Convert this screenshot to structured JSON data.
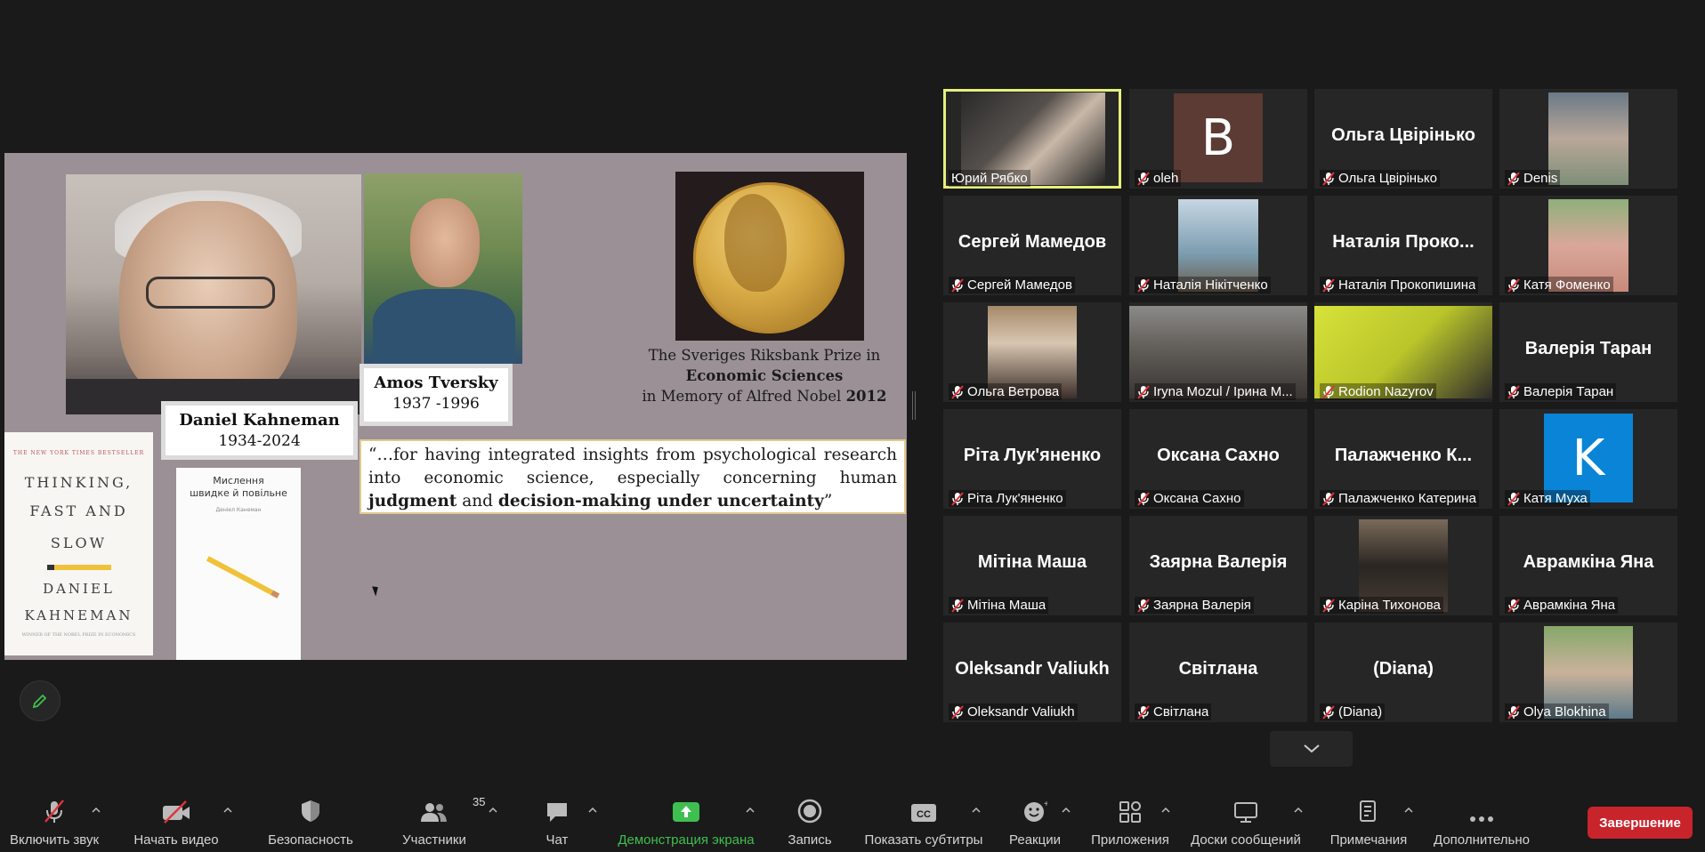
{
  "slide": {
    "kahneman_name": "Daniel Kahneman",
    "kahneman_years": "1934-2024",
    "tversky_name": "Amos Tversky",
    "tversky_years": "1937 -1996",
    "prize_line1": "The Sveriges Riksbank Prize in",
    "prize_line2": "Economic Sciences",
    "prize_line3a": "in Memory of Alfred Nobel ",
    "prize_line3b": "2012",
    "quote_a": "“…for having integrated insights from psychological research into economic science, especially concerning human ",
    "quote_b": "judgment",
    "quote_c": " and ",
    "quote_d": "decision-making under uncertainty",
    "quote_e": "”",
    "book1_top": "THE NEW YORK TIMES BESTSELLER",
    "book1_title_1": "THINKING,",
    "book1_title_2": "FAST AND SLOW",
    "book1_author_1": "DANIEL",
    "book1_author_2": "KAHNEMAN",
    "book1_winner": "WINNER OF THE NOBEL PRIZE IN ECONOMICS",
    "book2_title_1": "Мислення",
    "book2_title_2": "швидке й повільне",
    "book2_author": "Деніел Канеман"
  },
  "participants": [
    {
      "name": "Юрий Рябко",
      "big": "",
      "muted": false,
      "type": "video",
      "active": true
    },
    {
      "name": "oleh",
      "big": "",
      "muted": true,
      "type": "letter",
      "letter": "B",
      "color": "#5b3b33"
    },
    {
      "name": "Ольга Цвірінько",
      "big": "Ольга Цвірінько",
      "muted": true,
      "type": "name"
    },
    {
      "name": "Denis",
      "big": "",
      "muted": true,
      "type": "photo"
    },
    {
      "name": "Сергей Мамедов",
      "big": "Сергей Мамедов",
      "muted": true,
      "type": "name"
    },
    {
      "name": "Наталія Нікітченко",
      "big": "",
      "muted": true,
      "type": "photo"
    },
    {
      "name": "Наталія Прокопишина",
      "big": "Наталія Проко...",
      "muted": true,
      "type": "name"
    },
    {
      "name": "Катя Фоменко",
      "big": "",
      "muted": true,
      "type": "photo"
    },
    {
      "name": "Ольга Ветрова",
      "big": "",
      "muted": true,
      "type": "photo"
    },
    {
      "name": "Iryna Mozul / Ірина М...",
      "big": "",
      "muted": true,
      "type": "video"
    },
    {
      "name": "Rodion Nazyrov",
      "big": "",
      "muted": true,
      "type": "video"
    },
    {
      "name": "Валерія Таран",
      "big": "Валерія Таран",
      "muted": true,
      "type": "name"
    },
    {
      "name": "Ріта Лук'яненко",
      "big": "Ріта Лук'яненко",
      "muted": true,
      "type": "name"
    },
    {
      "name": "Оксана Сахно",
      "big": "Оксана Сахно",
      "muted": true,
      "type": "name"
    },
    {
      "name": "Палажченко Катерина",
      "big": "Палажченко К...",
      "muted": true,
      "type": "name"
    },
    {
      "name": "Катя Муха",
      "big": "",
      "muted": true,
      "type": "letter",
      "letter": "K",
      "color": "#0a84d6"
    },
    {
      "name": "Мітіна Маша",
      "big": "Мітіна Маша",
      "muted": true,
      "type": "name"
    },
    {
      "name": "Заярна Валерія",
      "big": "Заярна Валерія",
      "muted": true,
      "type": "name"
    },
    {
      "name": "Каріна Тихонова",
      "big": "",
      "muted": true,
      "type": "photo"
    },
    {
      "name": "Аврамкіна Яна",
      "big": "Аврамкіна Яна",
      "muted": true,
      "type": "name"
    },
    {
      "name": "Oleksandr Valiukh",
      "big": "Oleksandr Valiukh",
      "muted": true,
      "type": "name"
    },
    {
      "name": "Світлана",
      "big": "Світлана",
      "muted": true,
      "type": "name"
    },
    {
      "name": "(Diana)",
      "big": "(Diana)",
      "muted": true,
      "type": "name"
    },
    {
      "name": "Olya Blokhina",
      "big": "",
      "muted": true,
      "type": "photo"
    }
  ],
  "toolbar": {
    "audio": "Включить звук",
    "video": "Начать видео",
    "security": "Безопасность",
    "participants": "Участники",
    "participants_count": "35",
    "chat": "Чат",
    "share": "Демонстрация экрана",
    "record": "Запись",
    "captions": "Показать субтитры",
    "reactions": "Реакции",
    "apps": "Приложения",
    "whiteboards": "Доски сообщений",
    "notes": "Примечания",
    "more": "Дополнительно",
    "end": "Завершение",
    "accent": "#3fbf4f",
    "end_color": "#c8242c"
  }
}
